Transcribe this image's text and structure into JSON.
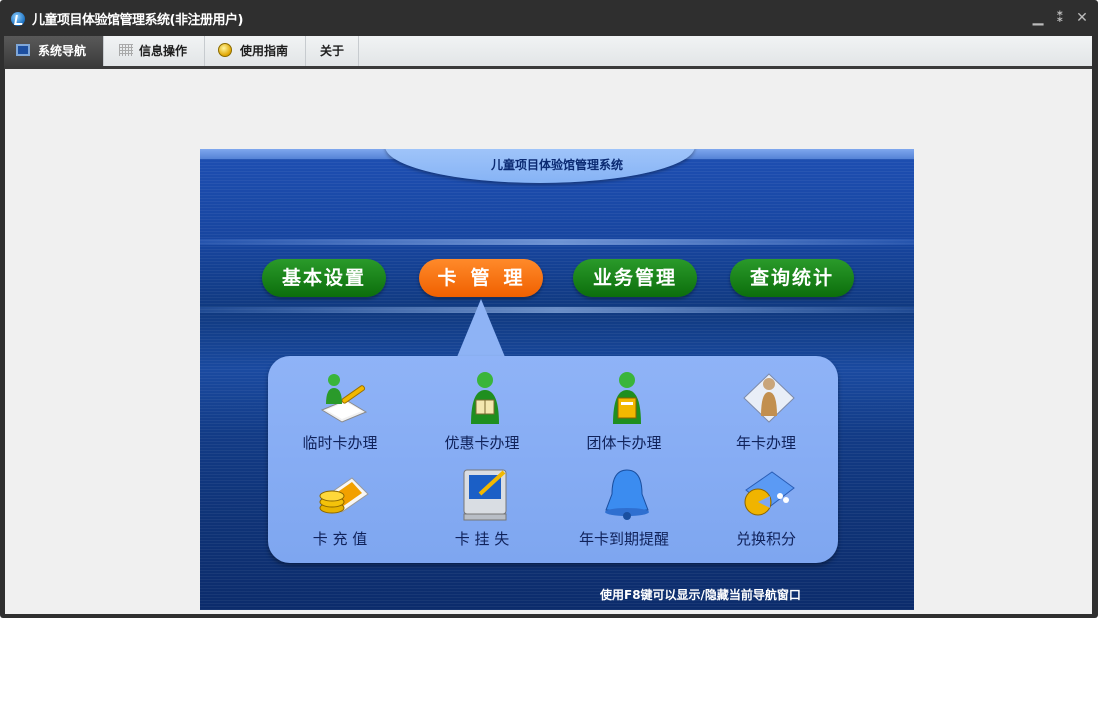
{
  "window": {
    "title": "儿童项目体验馆管理系统(非注册用户)",
    "controls": {
      "minimize": "▁",
      "restore": "⁑",
      "close": "✕"
    }
  },
  "menu": {
    "tabs": [
      {
        "label": "系统导航",
        "icon": "monitor-icon",
        "active": true
      },
      {
        "label": "信息操作",
        "icon": "grid-icon",
        "active": false
      },
      {
        "label": "使用指南",
        "icon": "guide-icon",
        "active": false
      },
      {
        "label": "关于",
        "icon": "",
        "active": false
      }
    ]
  },
  "panel": {
    "title": "儿童项目体验馆管理系统",
    "main_tabs": [
      {
        "label": "基本设置",
        "state": "normal"
      },
      {
        "label": "卡管理",
        "state": "selected"
      },
      {
        "label": "业务管理",
        "state": "normal"
      },
      {
        "label": "查询统计",
        "state": "normal"
      }
    ],
    "items": [
      {
        "label": "临时卡办理",
        "icon": "user-edit-icon"
      },
      {
        "label": "优惠卡办理",
        "icon": "user-book-icon"
      },
      {
        "label": "团体卡办理",
        "icon": "user-card-icon"
      },
      {
        "label": "年卡办理",
        "icon": "user-document-icon"
      },
      {
        "label": "卡 充 值",
        "icon": "coins-card-icon"
      },
      {
        "label": "卡 挂 失",
        "icon": "computer-icon"
      },
      {
        "label": "年卡到期提醒",
        "icon": "bell-icon"
      },
      {
        "label": "兑换积分",
        "icon": "palette-icon"
      }
    ],
    "hint": "使用F8键可以显示/隐藏当前导航窗口"
  },
  "colors": {
    "accent_selected": "#f06000",
    "tab_green": "#0c6e0c",
    "panel_blue": "#1a4aa0"
  }
}
